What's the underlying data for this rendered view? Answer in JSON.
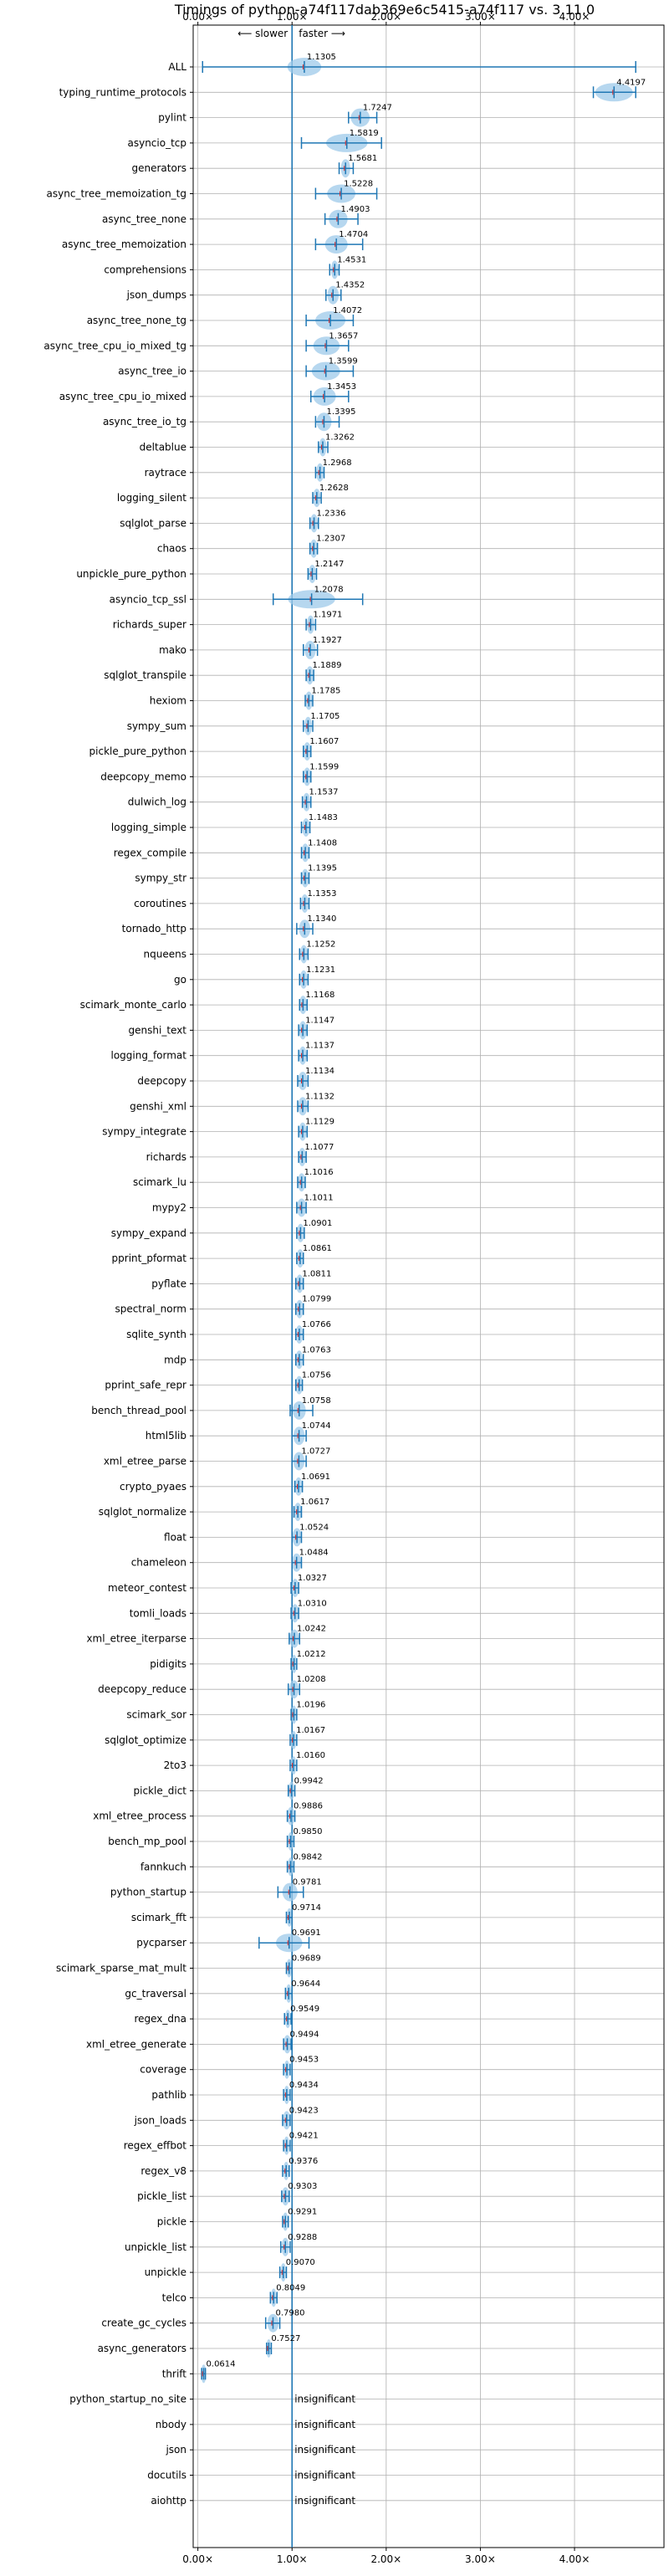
{
  "chart_data": {
    "type": "violin",
    "title": "Timings of python-a74f117dab369e6c5415-a74f117 vs. 3.11.0",
    "xlabel": "",
    "ylabel": "",
    "x_ticks": [
      "0.00×",
      "1.00×",
      "2.00×",
      "3.00×",
      "4.00×"
    ],
    "xlim": [
      -0.05,
      4.95
    ],
    "grid": true,
    "direction_labels": {
      "slower": "⟵ slower",
      "faster": "faster ⟶"
    },
    "insignificant_label": "insignificant",
    "reference_line": 1.0,
    "rows": [
      {
        "name": "ALL",
        "value": 1.1305,
        "label": "1.1305",
        "low": 0.05,
        "high": 4.65,
        "spread": 0.18
      },
      {
        "name": "typing_runtime_protocols",
        "value": 4.4197,
        "label": "4.4197",
        "low": 4.2,
        "high": 4.65,
        "spread": 0.2
      },
      {
        "name": "pylint",
        "value": 1.7247,
        "label": "1.7247",
        "low": 1.6,
        "high": 1.9,
        "spread": 0.1
      },
      {
        "name": "asyncio_tcp",
        "value": 1.5819,
        "label": "1.5819",
        "low": 1.1,
        "high": 1.95,
        "spread": 0.22
      },
      {
        "name": "generators",
        "value": 1.5681,
        "label": "1.5681",
        "low": 1.5,
        "high": 1.65,
        "spread": 0.05
      },
      {
        "name": "async_tree_memoization_tg",
        "value": 1.5228,
        "label": "1.5228",
        "low": 1.25,
        "high": 1.9,
        "spread": 0.15
      },
      {
        "name": "async_tree_none",
        "value": 1.4903,
        "label": "1.4903",
        "low": 1.35,
        "high": 1.7,
        "spread": 0.1
      },
      {
        "name": "async_tree_memoization",
        "value": 1.4704,
        "label": "1.4704",
        "low": 1.25,
        "high": 1.75,
        "spread": 0.12
      },
      {
        "name": "comprehensions",
        "value": 1.4531,
        "label": "1.4531",
        "low": 1.4,
        "high": 1.5,
        "spread": 0.04
      },
      {
        "name": "json_dumps",
        "value": 1.4352,
        "label": "1.4352",
        "low": 1.36,
        "high": 1.52,
        "spread": 0.06
      },
      {
        "name": "async_tree_none_tg",
        "value": 1.4072,
        "label": "1.4072",
        "low": 1.15,
        "high": 1.65,
        "spread": 0.16
      },
      {
        "name": "async_tree_cpu_io_mixed_tg",
        "value": 1.3657,
        "label": "1.3657",
        "low": 1.15,
        "high": 1.6,
        "spread": 0.14
      },
      {
        "name": "async_tree_io",
        "value": 1.3599,
        "label": "1.3599",
        "low": 1.15,
        "high": 1.65,
        "spread": 0.15
      },
      {
        "name": "async_tree_cpu_io_mixed",
        "value": 1.3453,
        "label": "1.3453",
        "low": 1.2,
        "high": 1.6,
        "spread": 0.12
      },
      {
        "name": "async_tree_io_tg",
        "value": 1.3395,
        "label": "1.3395",
        "low": 1.25,
        "high": 1.5,
        "spread": 0.08
      },
      {
        "name": "deltablue",
        "value": 1.3262,
        "label": "1.3262",
        "low": 1.28,
        "high": 1.38,
        "spread": 0.04
      },
      {
        "name": "raytrace",
        "value": 1.2968,
        "label": "1.2968",
        "low": 1.25,
        "high": 1.34,
        "spread": 0.04
      },
      {
        "name": "logging_silent",
        "value": 1.2628,
        "label": "1.2628",
        "low": 1.22,
        "high": 1.31,
        "spread": 0.04
      },
      {
        "name": "sqlglot_parse",
        "value": 1.2336,
        "label": "1.2336",
        "low": 1.19,
        "high": 1.28,
        "spread": 0.04
      },
      {
        "name": "chaos",
        "value": 1.2307,
        "label": "1.2307",
        "low": 1.19,
        "high": 1.27,
        "spread": 0.04
      },
      {
        "name": "unpickle_pure_python",
        "value": 1.2147,
        "label": "1.2147",
        "low": 1.17,
        "high": 1.26,
        "spread": 0.04
      },
      {
        "name": "asyncio_tcp_ssl",
        "value": 1.2078,
        "label": "1.2078",
        "low": 0.8,
        "high": 1.75,
        "spread": 0.25
      },
      {
        "name": "richards_super",
        "value": 1.1971,
        "label": "1.1971",
        "low": 1.15,
        "high": 1.25,
        "spread": 0.04
      },
      {
        "name": "mako",
        "value": 1.1927,
        "label": "1.1927",
        "low": 1.12,
        "high": 1.27,
        "spread": 0.06
      },
      {
        "name": "sqlglot_transpile",
        "value": 1.1889,
        "label": "1.1889",
        "low": 1.15,
        "high": 1.23,
        "spread": 0.04
      },
      {
        "name": "hexiom",
        "value": 1.1785,
        "label": "1.1785",
        "low": 1.14,
        "high": 1.22,
        "spread": 0.04
      },
      {
        "name": "sympy_sum",
        "value": 1.1705,
        "label": "1.1705",
        "low": 1.12,
        "high": 1.22,
        "spread": 0.04
      },
      {
        "name": "pickle_pure_python",
        "value": 1.1607,
        "label": "1.1607",
        "low": 1.12,
        "high": 1.2,
        "spread": 0.04
      },
      {
        "name": "deepcopy_memo",
        "value": 1.1599,
        "label": "1.1599",
        "low": 1.12,
        "high": 1.2,
        "spread": 0.04
      },
      {
        "name": "dulwich_log",
        "value": 1.1537,
        "label": "1.1537",
        "low": 1.11,
        "high": 1.2,
        "spread": 0.04
      },
      {
        "name": "logging_simple",
        "value": 1.1483,
        "label": "1.1483",
        "low": 1.1,
        "high": 1.19,
        "spread": 0.04
      },
      {
        "name": "regex_compile",
        "value": 1.1408,
        "label": "1.1408",
        "low": 1.1,
        "high": 1.18,
        "spread": 0.04
      },
      {
        "name": "sympy_str",
        "value": 1.1395,
        "label": "1.1395",
        "low": 1.1,
        "high": 1.18,
        "spread": 0.04
      },
      {
        "name": "coroutines",
        "value": 1.1353,
        "label": "1.1353",
        "low": 1.09,
        "high": 1.18,
        "spread": 0.04
      },
      {
        "name": "tornado_http",
        "value": 1.134,
        "label": "1.1340",
        "low": 1.05,
        "high": 1.22,
        "spread": 0.06
      },
      {
        "name": "nqueens",
        "value": 1.1252,
        "label": "1.1252",
        "low": 1.08,
        "high": 1.17,
        "spread": 0.04
      },
      {
        "name": "go",
        "value": 1.1231,
        "label": "1.1231",
        "low": 1.08,
        "high": 1.17,
        "spread": 0.04
      },
      {
        "name": "scimark_monte_carlo",
        "value": 1.1168,
        "label": "1.1168",
        "low": 1.08,
        "high": 1.16,
        "spread": 0.04
      },
      {
        "name": "genshi_text",
        "value": 1.1147,
        "label": "1.1147",
        "low": 1.07,
        "high": 1.16,
        "spread": 0.04
      },
      {
        "name": "logging_format",
        "value": 1.1137,
        "label": "1.1137",
        "low": 1.07,
        "high": 1.16,
        "spread": 0.04
      },
      {
        "name": "deepcopy",
        "value": 1.1134,
        "label": "1.1134",
        "low": 1.06,
        "high": 1.17,
        "spread": 0.05
      },
      {
        "name": "genshi_xml",
        "value": 1.1132,
        "label": "1.1132",
        "low": 1.06,
        "high": 1.17,
        "spread": 0.05
      },
      {
        "name": "sympy_integrate",
        "value": 1.1129,
        "label": "1.1129",
        "low": 1.07,
        "high": 1.16,
        "spread": 0.04
      },
      {
        "name": "richards",
        "value": 1.1077,
        "label": "1.1077",
        "low": 1.07,
        "high": 1.15,
        "spread": 0.04
      },
      {
        "name": "scimark_lu",
        "value": 1.1016,
        "label": "1.1016",
        "low": 1.06,
        "high": 1.14,
        "spread": 0.04
      },
      {
        "name": "mypy2",
        "value": 1.1011,
        "label": "1.1011",
        "low": 1.05,
        "high": 1.15,
        "spread": 0.05
      },
      {
        "name": "sympy_expand",
        "value": 1.0901,
        "label": "1.0901",
        "low": 1.05,
        "high": 1.13,
        "spread": 0.04
      },
      {
        "name": "pprint_pformat",
        "value": 1.0861,
        "label": "1.0861",
        "low": 1.05,
        "high": 1.12,
        "spread": 0.04
      },
      {
        "name": "pyflate",
        "value": 1.0811,
        "label": "1.0811",
        "low": 1.04,
        "high": 1.12,
        "spread": 0.04
      },
      {
        "name": "spectral_norm",
        "value": 1.0799,
        "label": "1.0799",
        "low": 1.04,
        "high": 1.12,
        "spread": 0.04
      },
      {
        "name": "sqlite_synth",
        "value": 1.0766,
        "label": "1.0766",
        "low": 1.04,
        "high": 1.12,
        "spread": 0.04
      },
      {
        "name": "mdp",
        "value": 1.0763,
        "label": "1.0763",
        "low": 1.04,
        "high": 1.12,
        "spread": 0.04
      },
      {
        "name": "pprint_safe_repr",
        "value": 1.0756,
        "label": "1.0756",
        "low": 1.04,
        "high": 1.11,
        "spread": 0.04
      },
      {
        "name": "bench_thread_pool",
        "value": 1.0758,
        "label": "1.0758",
        "low": 0.98,
        "high": 1.22,
        "spread": 0.07
      },
      {
        "name": "html5lib",
        "value": 1.0744,
        "label": "1.0744",
        "low": 1.0,
        "high": 1.15,
        "spread": 0.06
      },
      {
        "name": "xml_etree_parse",
        "value": 1.0727,
        "label": "1.0727",
        "low": 1.0,
        "high": 1.15,
        "spread": 0.06
      },
      {
        "name": "crypto_pyaes",
        "value": 1.0691,
        "label": "1.0691",
        "low": 1.03,
        "high": 1.11,
        "spread": 0.04
      },
      {
        "name": "sqlglot_normalize",
        "value": 1.0617,
        "label": "1.0617",
        "low": 1.02,
        "high": 1.1,
        "spread": 0.04
      },
      {
        "name": "float",
        "value": 1.0524,
        "label": "1.0524",
        "low": 1.0,
        "high": 1.1,
        "spread": 0.05
      },
      {
        "name": "chameleon",
        "value": 1.0484,
        "label": "1.0484",
        "low": 1.0,
        "high": 1.1,
        "spread": 0.05
      },
      {
        "name": "meteor_contest",
        "value": 1.0327,
        "label": "1.0327",
        "low": 0.99,
        "high": 1.07,
        "spread": 0.04
      },
      {
        "name": "tomli_loads",
        "value": 1.031,
        "label": "1.0310",
        "low": 0.99,
        "high": 1.07,
        "spread": 0.04
      },
      {
        "name": "xml_etree_iterparse",
        "value": 1.0242,
        "label": "1.0242",
        "low": 0.97,
        "high": 1.08,
        "spread": 0.05
      },
      {
        "name": "pidigits",
        "value": 1.0212,
        "label": "1.0212",
        "low": 0.99,
        "high": 1.05,
        "spread": 0.03
      },
      {
        "name": "deepcopy_reduce",
        "value": 1.0208,
        "label": "1.0208",
        "low": 0.96,
        "high": 1.08,
        "spread": 0.05
      },
      {
        "name": "scimark_sor",
        "value": 1.0196,
        "label": "1.0196",
        "low": 0.99,
        "high": 1.05,
        "spread": 0.03
      },
      {
        "name": "sqlglot_optimize",
        "value": 1.0167,
        "label": "1.0167",
        "low": 0.98,
        "high": 1.05,
        "spread": 0.03
      },
      {
        "name": "2to3",
        "value": 1.016,
        "label": "1.0160",
        "low": 0.98,
        "high": 1.05,
        "spread": 0.03
      },
      {
        "name": "pickle_dict",
        "value": 0.9942,
        "label": "0.9942",
        "low": 0.96,
        "high": 1.03,
        "spread": 0.03
      },
      {
        "name": "xml_etree_process",
        "value": 0.9886,
        "label": "0.9886",
        "low": 0.95,
        "high": 1.03,
        "spread": 0.04
      },
      {
        "name": "bench_mp_pool",
        "value": 0.985,
        "label": "0.9850",
        "low": 0.95,
        "high": 1.02,
        "spread": 0.03
      },
      {
        "name": "fannkuch",
        "value": 0.9842,
        "label": "0.9842",
        "low": 0.95,
        "high": 1.02,
        "spread": 0.03
      },
      {
        "name": "python_startup",
        "value": 0.9781,
        "label": "0.9781",
        "low": 0.85,
        "high": 1.12,
        "spread": 0.08
      },
      {
        "name": "scimark_fft",
        "value": 0.9714,
        "label": "0.9714",
        "low": 0.94,
        "high": 1.0,
        "spread": 0.03
      },
      {
        "name": "pycparser",
        "value": 0.9691,
        "label": "0.9691",
        "low": 0.65,
        "high": 1.18,
        "spread": 0.14
      },
      {
        "name": "scimark_sparse_mat_mult",
        "value": 0.9689,
        "label": "0.9689",
        "low": 0.94,
        "high": 1.0,
        "spread": 0.03
      },
      {
        "name": "gc_traversal",
        "value": 0.9644,
        "label": "0.9644",
        "low": 0.93,
        "high": 1.0,
        "spread": 0.03
      },
      {
        "name": "regex_dna",
        "value": 0.9549,
        "label": "0.9549",
        "low": 0.92,
        "high": 0.99,
        "spread": 0.03
      },
      {
        "name": "xml_etree_generate",
        "value": 0.9494,
        "label": "0.9494",
        "low": 0.91,
        "high": 0.99,
        "spread": 0.04
      },
      {
        "name": "coverage",
        "value": 0.9453,
        "label": "0.9453",
        "low": 0.91,
        "high": 0.98,
        "spread": 0.03
      },
      {
        "name": "pathlib",
        "value": 0.9434,
        "label": "0.9434",
        "low": 0.91,
        "high": 0.98,
        "spread": 0.03
      },
      {
        "name": "json_loads",
        "value": 0.9423,
        "label": "0.9423",
        "low": 0.9,
        "high": 0.98,
        "spread": 0.04
      },
      {
        "name": "regex_effbot",
        "value": 0.9421,
        "label": "0.9421",
        "low": 0.91,
        "high": 0.98,
        "spread": 0.03
      },
      {
        "name": "regex_v8",
        "value": 0.9376,
        "label": "0.9376",
        "low": 0.9,
        "high": 0.97,
        "spread": 0.03
      },
      {
        "name": "pickle_list",
        "value": 0.9303,
        "label": "0.9303",
        "low": 0.89,
        "high": 0.97,
        "spread": 0.04
      },
      {
        "name": "pickle",
        "value": 0.9291,
        "label": "0.9291",
        "low": 0.9,
        "high": 0.96,
        "spread": 0.03
      },
      {
        "name": "unpickle_list",
        "value": 0.9288,
        "label": "0.9288",
        "low": 0.88,
        "high": 0.98,
        "spread": 0.04
      },
      {
        "name": "unpickle",
        "value": 0.907,
        "label": "0.9070",
        "low": 0.87,
        "high": 0.94,
        "spread": 0.03
      },
      {
        "name": "telco",
        "value": 0.8049,
        "label": "0.8049",
        "low": 0.77,
        "high": 0.84,
        "spread": 0.03
      },
      {
        "name": "create_gc_cycles",
        "value": 0.798,
        "label": "0.7980",
        "low": 0.72,
        "high": 0.87,
        "spread": 0.06
      },
      {
        "name": "async_generators",
        "value": 0.7527,
        "label": "0.7527",
        "low": 0.73,
        "high": 0.78,
        "spread": 0.02
      },
      {
        "name": "thrift",
        "value": 0.0614,
        "label": "0.0614",
        "low": 0.04,
        "high": 0.08,
        "spread": 0.01
      },
      {
        "name": "python_startup_no_site",
        "insignificant": true
      },
      {
        "name": "nbody",
        "insignificant": true
      },
      {
        "name": "json",
        "insignificant": true
      },
      {
        "name": "docutils",
        "insignificant": true
      },
      {
        "name": "aiohttp",
        "insignificant": true
      }
    ]
  }
}
